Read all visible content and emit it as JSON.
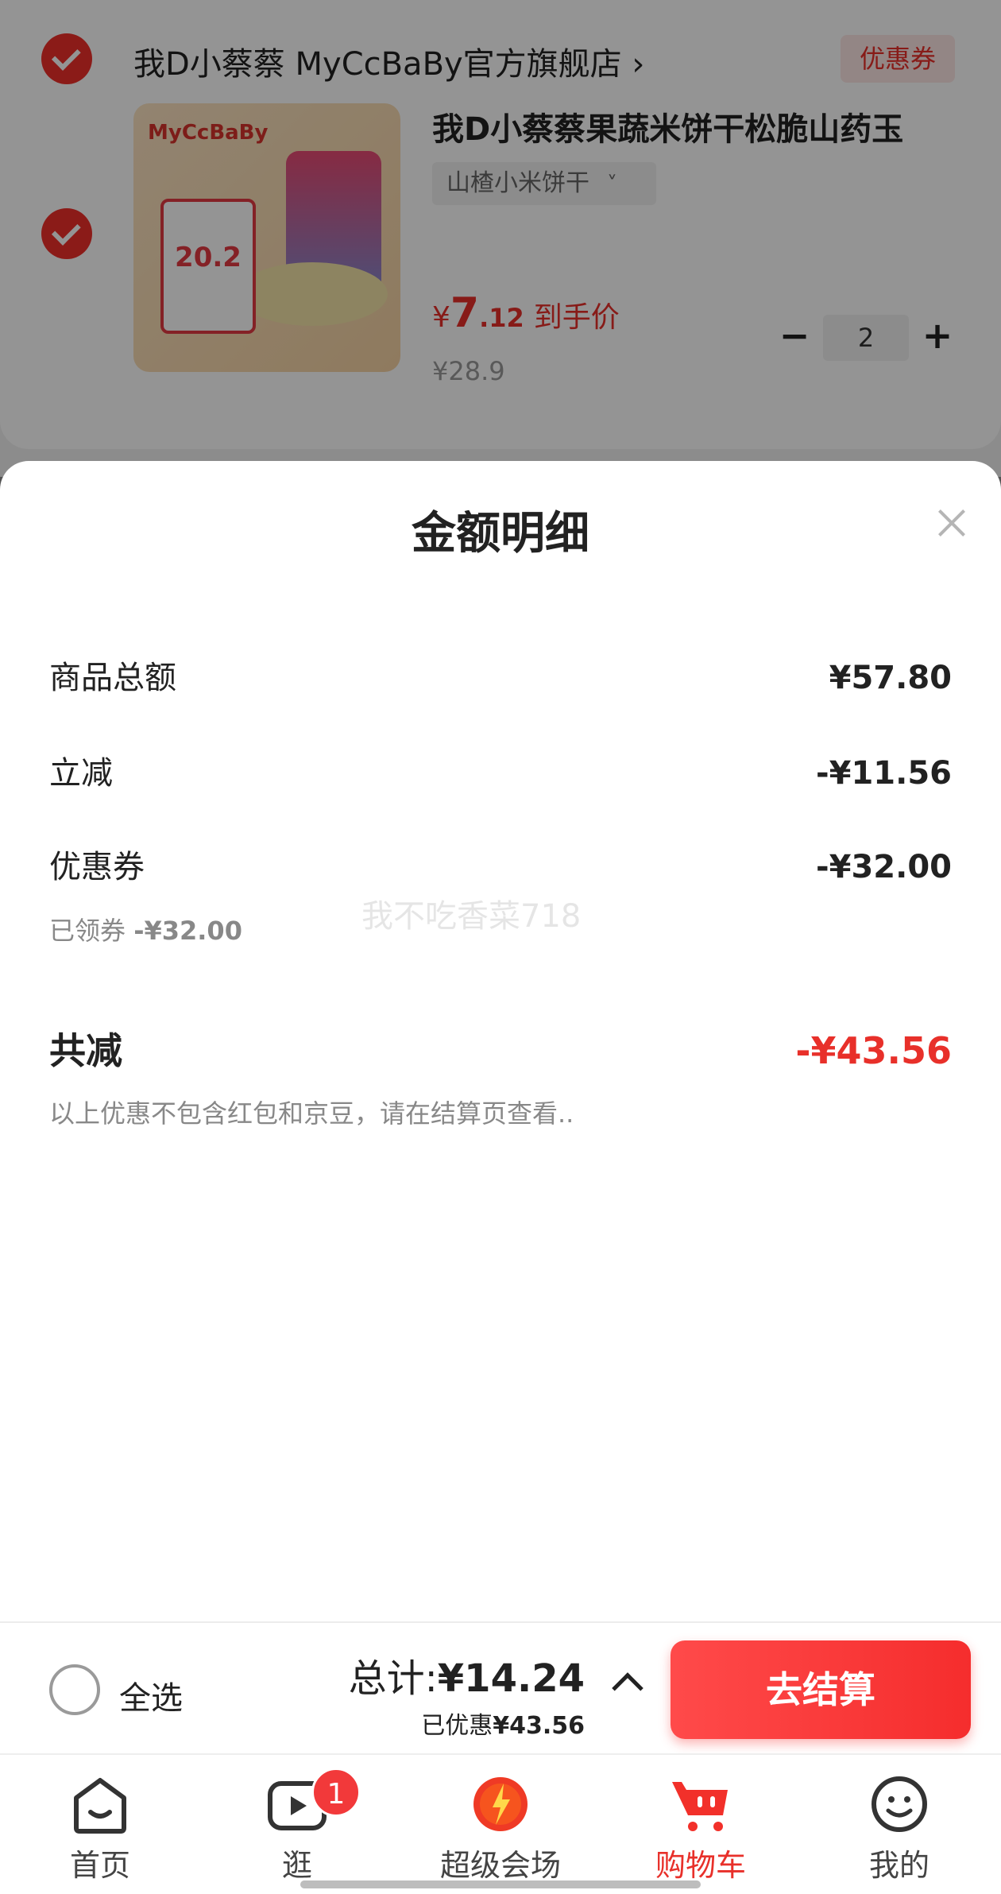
{
  "cart": {
    "shop_name": "我D小蔡蔡 MyCcBaBy官方旗舰店 ›",
    "coupon_tag": "优惠券",
    "product": {
      "image_promo_text": "20.2",
      "image_brand": "MyCcBaBy",
      "title": "我D小蔡蔡果蔬米饼干松脆山药玉",
      "variant": "山楂小米饼干",
      "price_currency": "¥",
      "price_int": "7",
      "price_dec": ".12",
      "price_suffix": "到手价",
      "original_price": "¥28.9",
      "quantity": "2",
      "minus": "−",
      "plus": "+"
    }
  },
  "sheet": {
    "title": "金额明细",
    "rows": [
      {
        "label": "商品总额",
        "value": "¥57.80"
      },
      {
        "label": "立减",
        "value": "-¥11.56"
      },
      {
        "label": "优惠券",
        "value": "-¥32.00"
      }
    ],
    "coupon_note_label": "已领券",
    "coupon_note_amount": "-¥32.00",
    "total_label": "共减",
    "total_value": "-¥43.56",
    "disclaimer": "以上优惠不包含红包和京豆，请在结算页查看..",
    "watermark": "我不吃香菜718"
  },
  "checkout": {
    "select_all": "全选",
    "total_label": "总计:",
    "total_amount": "¥14.24",
    "saved_label": "已优惠",
    "saved_amount": "¥43.56",
    "button": "去结算"
  },
  "tabs": [
    {
      "label": "首页",
      "icon": "home-icon"
    },
    {
      "label": "逛",
      "icon": "video-icon",
      "badge": "1"
    },
    {
      "label": "超级会场",
      "icon": "super-venue-icon"
    },
    {
      "label": "购物车",
      "icon": "cart-icon",
      "active": true
    },
    {
      "label": "我的",
      "icon": "profile-icon"
    }
  ],
  "colors": {
    "accent": "#e8302a",
    "checkout_button": "#f52d2d"
  }
}
